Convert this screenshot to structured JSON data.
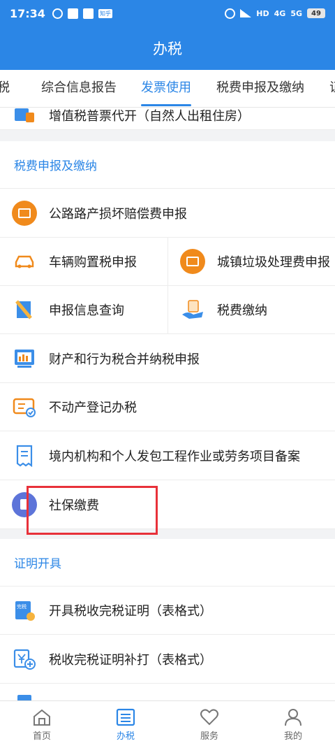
{
  "statusbar": {
    "time": "17:34",
    "network_label": "HD",
    "signal1": "4G",
    "signal2": "5G",
    "battery": "49"
  },
  "header": {
    "title": "办税"
  },
  "tabs": [
    {
      "label": "税",
      "active": false
    },
    {
      "label": "综合信息报告",
      "active": false
    },
    {
      "label": "发票使用",
      "active": true
    },
    {
      "label": "税费申报及缴纳",
      "active": false
    },
    {
      "label": "证",
      "active": false
    }
  ],
  "partial_item": {
    "label": "增值税普票代开（自然人出租住房）"
  },
  "section_tax": {
    "title": "税费申报及缴纳",
    "items": [
      {
        "label": "公路路产损坏赔偿费申报",
        "icon": "orange-receipt-icon"
      },
      {
        "label": "车辆购置税申报",
        "icon": "car-icon"
      },
      {
        "label": "城镇垃圾处理费申报",
        "icon": "orange-calendar-icon"
      },
      {
        "label": "申报信息查询",
        "icon": "document-search-icon"
      },
      {
        "label": "税费缴纳",
        "icon": "tax-hand-icon"
      },
      {
        "label": "财产和行为税合并纳税申报",
        "icon": "chart-board-icon"
      },
      {
        "label": "不动产登记办税",
        "icon": "ticket-check-icon"
      },
      {
        "label": "境内机构和个人发包工程作业或劳务项目备案",
        "icon": "receipt-list-icon"
      },
      {
        "label": "社保缴费",
        "icon": "social-security-icon"
      }
    ]
  },
  "section_cert": {
    "title": "证明开具",
    "items": [
      {
        "label": "开具税收完税证明（表格式）",
        "icon": "tax-certificate-icon",
        "badge": "完税"
      },
      {
        "label": "税收完税证明补打（表格式）",
        "icon": "yuan-add-icon"
      }
    ]
  },
  "bottom_nav": [
    {
      "label": "首页",
      "icon": "home-icon",
      "active": false
    },
    {
      "label": "办税",
      "icon": "list-icon",
      "active": true
    },
    {
      "label": "服务",
      "icon": "heart-icon",
      "active": false
    },
    {
      "label": "我的",
      "icon": "user-icon",
      "active": false
    }
  ],
  "colors": {
    "primary": "#2b86e6",
    "orange": "#f08a1c",
    "highlight_red": "#e8313a",
    "social_blue": "#5d74d9"
  }
}
